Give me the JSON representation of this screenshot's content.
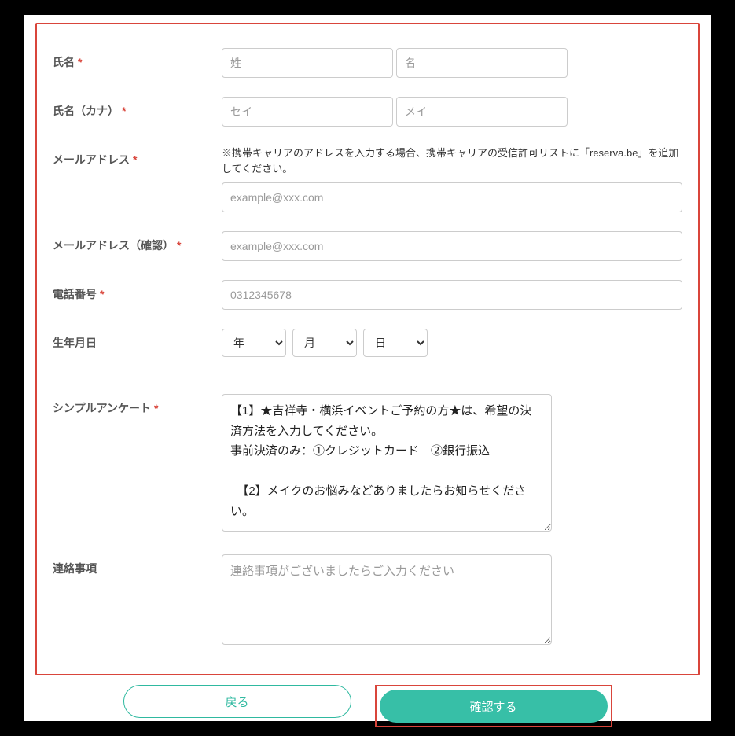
{
  "form": {
    "name": {
      "label": "氏名",
      "lastname_placeholder": "姓",
      "firstname_placeholder": "名"
    },
    "kana": {
      "label": "氏名（カナ）",
      "lastname_placeholder": "セイ",
      "firstname_placeholder": "メイ"
    },
    "email": {
      "label": "メールアドレス",
      "note": "※携帯キャリアのアドレスを入力する場合、携帯キャリアの受信許可リストに「reserva.be」を追加してください。",
      "placeholder": "example@xxx.com"
    },
    "email_confirm": {
      "label": "メールアドレス（確認）",
      "placeholder": "example@xxx.com"
    },
    "phone": {
      "label": "電話番号",
      "placeholder": "0312345678"
    },
    "birth": {
      "label": "生年月日",
      "year": "年",
      "month": "月",
      "day": "日"
    },
    "survey": {
      "label": "シンプルアンケート",
      "text": "【1】★吉祥寺・横浜イベントご予約の方★は、希望の決済方法を入力してください。\n事前決済のみ：①クレジットカード　②銀行振込\n\n  【2】メイクのお悩みなどありましたらお知らせください。"
    },
    "contact": {
      "label": "連絡事項",
      "placeholder": "連絡事項がございましたらご入力ください"
    }
  },
  "buttons": {
    "back": "戻る",
    "confirm": "確認する"
  },
  "required_mark": "*"
}
